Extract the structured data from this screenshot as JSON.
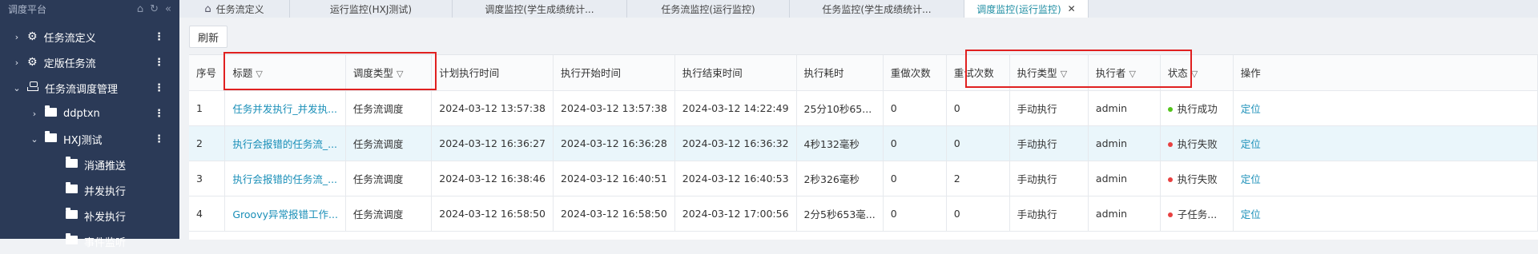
{
  "sidebar": {
    "title": "调度平台",
    "items": [
      {
        "label": "任务流定义",
        "arrow": "›",
        "icon": "flow-icon",
        "level": 0
      },
      {
        "label": "定版任务流",
        "arrow": "›",
        "icon": "flow-icon",
        "level": 0
      },
      {
        "label": "任务流调度管理",
        "arrow": "⌄",
        "icon": "node-icon",
        "level": 0
      },
      {
        "label": "ddptxn",
        "arrow": "›",
        "icon": "folder-icon",
        "level": 1
      },
      {
        "label": "HXJ测试",
        "arrow": "⌄",
        "icon": "folder-icon",
        "level": 1
      },
      {
        "label": "消通推送",
        "arrow": "",
        "icon": "folder-icon",
        "level": 2
      },
      {
        "label": "并发执行",
        "arrow": "",
        "icon": "folder-icon",
        "level": 2
      },
      {
        "label": "补发执行",
        "arrow": "",
        "icon": "folder-icon",
        "level": 2
      },
      {
        "label": "事件监听",
        "arrow": "",
        "icon": "folder-icon",
        "level": 2
      }
    ]
  },
  "tabs": [
    {
      "label": "任务流定义",
      "active": false,
      "home": true
    },
    {
      "label": "运行监控(HXJ测试)",
      "active": false
    },
    {
      "label": "调度监控(学生成绩统计...",
      "active": false
    },
    {
      "label": "任务流监控(运行监控)",
      "active": false
    },
    {
      "label": "任务监控(学生成绩统计...",
      "active": false
    },
    {
      "label": "调度监控(运行监控)",
      "active": true
    }
  ],
  "toolbar": {
    "refresh_label": "刷新"
  },
  "table": {
    "columns": [
      "序号",
      "标题",
      "调度类型",
      "计划执行时间",
      "执行开始时间",
      "执行结束时间",
      "执行耗时",
      "重做次数",
      "重试次数",
      "执行类型",
      "执行者",
      "状态",
      "操作"
    ],
    "rows": [
      {
        "no": "1",
        "title": "任务并发执行_并发执...",
        "sched_type": "任务流调度",
        "plan": "2024-03-12 13:57:38",
        "start": "2024-03-12 13:57:38",
        "end": "2024-03-12 14:22:49",
        "duration": "25分10秒65...",
        "redo": "0",
        "retry": "0",
        "exec_type": "手动执行",
        "executor": "admin",
        "status": "执行成功",
        "status_color": "#52c41a",
        "op": "定位"
      },
      {
        "no": "2",
        "title": "执行会报错的任务流_...",
        "sched_type": "任务流调度",
        "plan": "2024-03-12 16:36:27",
        "start": "2024-03-12 16:36:28",
        "end": "2024-03-12 16:36:32",
        "duration": "4秒132毫秒",
        "redo": "0",
        "retry": "0",
        "exec_type": "手动执行",
        "executor": "admin",
        "status": "执行失败",
        "status_color": "#e84040",
        "op": "定位"
      },
      {
        "no": "3",
        "title": "执行会报错的任务流_...",
        "sched_type": "任务流调度",
        "plan": "2024-03-12 16:38:46",
        "start": "2024-03-12 16:40:51",
        "end": "2024-03-12 16:40:53",
        "duration": "2秒326毫秒",
        "redo": "0",
        "retry": "2",
        "exec_type": "手动执行",
        "executor": "admin",
        "status": "执行失败",
        "status_color": "#e84040",
        "op": "定位"
      },
      {
        "no": "4",
        "title": "Groovy异常报错工作...",
        "sched_type": "任务流调度",
        "plan": "2024-03-12 16:58:50",
        "start": "2024-03-12 16:58:50",
        "end": "2024-03-12 17:00:56",
        "duration": "2分5秒653毫...",
        "redo": "0",
        "retry": "0",
        "exec_type": "手动执行",
        "executor": "admin",
        "status": "子任务...",
        "status_color": "#e84040",
        "op": "定位"
      }
    ]
  },
  "colors": {
    "sidebar_bg": "#2b3a57",
    "link": "#1a8fb8",
    "active_tab": "#1f8ea3",
    "highlight_box": "#e02020"
  }
}
